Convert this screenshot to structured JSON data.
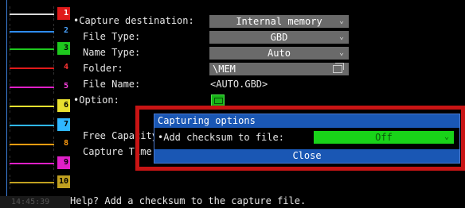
{
  "strip": {
    "channels": [
      {
        "num": "1",
        "color": "#d9d9d9",
        "num_bg": "#e01a1a",
        "num_color": "#ffffff"
      },
      {
        "num": "2",
        "color": "#2f8cf0",
        "num_bg": "#000000",
        "num_color": "#4aa3ff"
      },
      {
        "num": "3",
        "color": "#1ec81e",
        "num_bg": "#1ec81e",
        "num_color": "#000000"
      },
      {
        "num": "4",
        "color": "#e01a1a",
        "num_bg": "#000000",
        "num_color": "#ff3333"
      },
      {
        "num": "5",
        "color": "#e020c8",
        "num_bg": "#000000",
        "num_color": "#ff40e0"
      },
      {
        "num": "6",
        "color": "#e8e030",
        "num_bg": "#e8e030",
        "num_color": "#000000"
      },
      {
        "num": "7",
        "color": "#2fb7ff",
        "num_bg": "#2fb7ff",
        "num_color": "#000000"
      },
      {
        "num": "8",
        "color": "#ff9c10",
        "num_bg": "#000000",
        "num_color": "#ff9c10"
      },
      {
        "num": "9",
        "color": "#e020c8",
        "num_bg": "#e020c8",
        "num_color": "#000000"
      },
      {
        "num": "10",
        "color": "#c0a020",
        "num_bg": "#c0a020",
        "num_color": "#000000"
      }
    ],
    "time": "14:45:39"
  },
  "settings": {
    "capture_destination_label": "•Capture destination:",
    "capture_destination_value": "Internal memory",
    "file_type_label": "File Type:",
    "file_type_value": "GBD",
    "name_type_label": "Name Type:",
    "name_type_value": "Auto",
    "folder_label": "Folder:",
    "folder_value": "\\MEM",
    "file_name_label": "File Name:",
    "file_name_value": "<AUTO.GBD>",
    "option_label": "•Option:",
    "free_capacity_label": "Free Capacity",
    "capture_time_label": "Capture Time"
  },
  "dialog": {
    "title": "Capturing options",
    "row_label": "•Add checksum to file:",
    "row_value": "Off",
    "close_label": "Close"
  },
  "help_text": "Help?  Add a checksum to the capture file.",
  "icons": {
    "dropdown": "chevron-down-icon",
    "browse": "folder-browse-icon",
    "option": "option-settings-icon"
  }
}
